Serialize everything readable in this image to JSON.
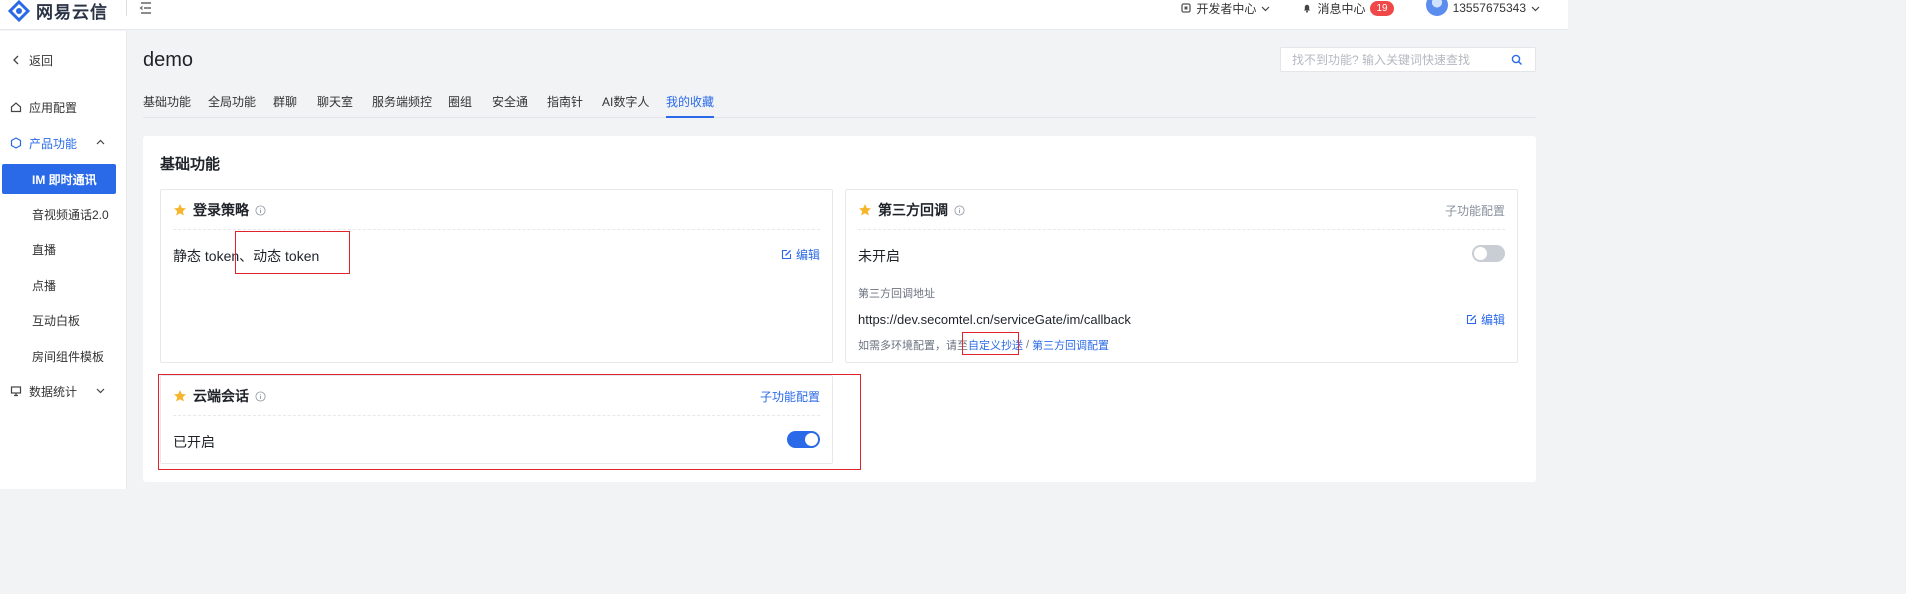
{
  "topbar": {
    "brand": "网易云信",
    "dev_center": "开发者中心",
    "messages": "消息中心",
    "message_count": "19",
    "account": "13557675343"
  },
  "sidebar": {
    "back": "返回",
    "app_config": "应用配置",
    "product_features": "产品功能",
    "items": [
      "IM 即时通讯",
      "音视频通话2.0",
      "直播",
      "点播",
      "互动白板",
      "房间组件模板"
    ],
    "data_stats": "数据统计"
  },
  "main": {
    "title": "demo",
    "search_placeholder": "找不到功能? 输入关键词快速查找",
    "tabs": [
      "基础功能",
      "全局功能",
      "群聊",
      "聊天室",
      "服务端频控",
      "圈组",
      "安全通",
      "指南针",
      "AI数字人",
      "我的收藏"
    ],
    "section_title": "基础功能"
  },
  "cards": {
    "login": {
      "title": "登录策略",
      "value": "静态 token、动态 token",
      "edit": "编辑"
    },
    "callback": {
      "title": "第三方回调",
      "sub_config": "子功能配置",
      "status": "未开启",
      "enabled": false,
      "address_label": "第三方回调地址",
      "address": "https://dev.secomtel.cn/serviceGate/im/callback",
      "edit": "编辑",
      "note_prefix": "如需多环境配置，请至",
      "note_link1": "自定义抄送",
      "note_sep": "/",
      "note_link2": "第三方回调配置"
    },
    "cloud": {
      "title": "云端会话",
      "sub_config": "子功能配置",
      "status": "已开启",
      "enabled": true
    }
  },
  "colors": {
    "accent": "#2a6ae9",
    "highlight": "#e0242b",
    "star": "#f7b52c",
    "badge": "#f04848"
  },
  "icons": [
    "logo-mark",
    "collapse-icon",
    "dev-center-icon",
    "bell-icon",
    "avatar",
    "chevron-down-icon",
    "back-chevron-icon",
    "home-icon",
    "hexagon-icon",
    "chevron-up-icon",
    "monitor-icon",
    "search-icon",
    "star-icon",
    "info-icon",
    "edit-icon"
  ]
}
